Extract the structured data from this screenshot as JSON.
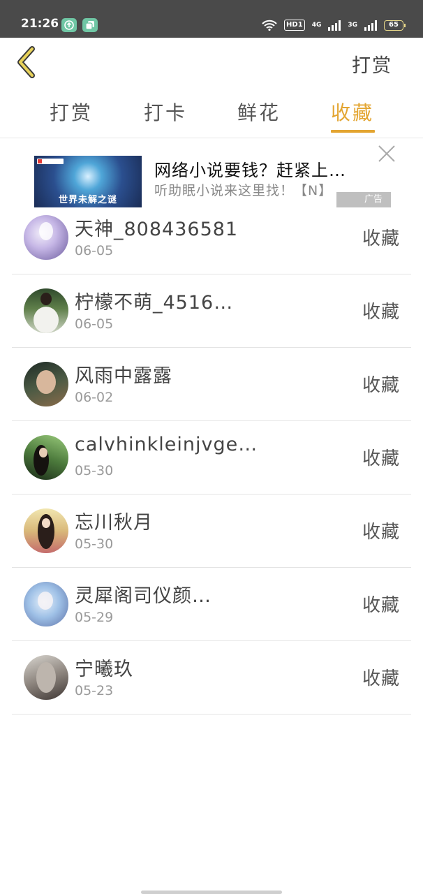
{
  "status_bar": {
    "time": "21:26",
    "hd": "HD1",
    "net1": "4G",
    "net2": "3G",
    "battery": "65"
  },
  "header": {
    "back_icon": "chevron-left-icon",
    "right_label": "打赏"
  },
  "tabs": [
    {
      "label": "打赏",
      "active": false
    },
    {
      "label": "打卡",
      "active": false
    },
    {
      "label": "鲜花",
      "active": false
    },
    {
      "label": "收藏",
      "active": true
    }
  ],
  "accent_color": "#e3a531",
  "ad": {
    "thumb_caption": "世界未解之谜",
    "title": "网络小说要钱？赶紧上…",
    "subtitle": "听助眠小说来这里找！【N】",
    "badge": "广告"
  },
  "list": [
    {
      "name": "天神_808436581",
      "date": "06-05",
      "action": "收藏"
    },
    {
      "name": "柠檬不萌_4516…",
      "date": "06-05",
      "action": "收藏"
    },
    {
      "name": "风雨中露露",
      "date": "06-02",
      "action": "收藏"
    },
    {
      "name": "calvhinkleinjvge…",
      "date": "05-30",
      "action": "收藏"
    },
    {
      "name": "忘川秋月",
      "date": "05-30",
      "action": "收藏"
    },
    {
      "name": "灵犀阁司仪颜…",
      "date": "05-29",
      "action": "收藏"
    },
    {
      "name": "宁曦玖",
      "date": "05-23",
      "action": "收藏"
    }
  ]
}
